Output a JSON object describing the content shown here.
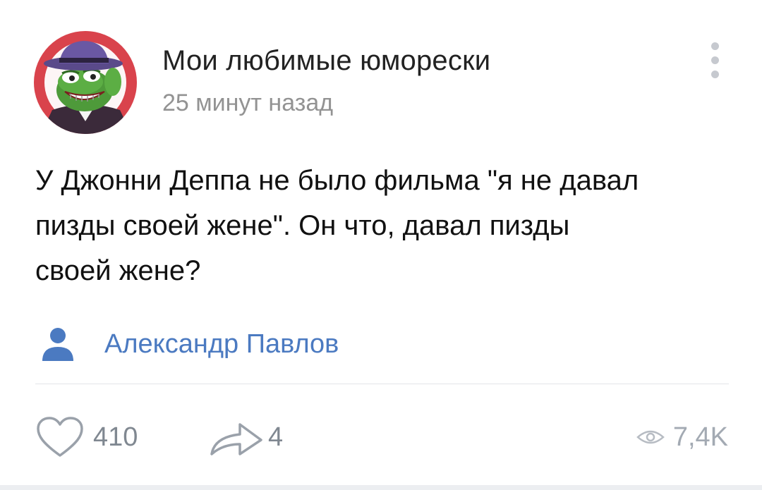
{
  "post": {
    "group_name": "Мои любимые юморески",
    "time": "25 минут назад",
    "text_lines": [
      "У Джонни Деппа не было фильма \"я не давал",
      "пизды своей жене\". Он что, давал пизды",
      "своей жене?"
    ],
    "author": {
      "name": "Александр Павлов",
      "icon": "user-icon"
    },
    "actions": {
      "likes": "410",
      "like_icon": "heart-icon",
      "shares": "4",
      "share_icon": "share-arrow-icon",
      "views": "7,4K",
      "views_icon": "eye-icon"
    },
    "menu_icon": "more-vertical-icon"
  },
  "colors": {
    "link": "#4b7ac1",
    "secondary_text": "#939393",
    "icon_gray": "#9aa1aa",
    "avatar_bg": "#d9434c"
  }
}
